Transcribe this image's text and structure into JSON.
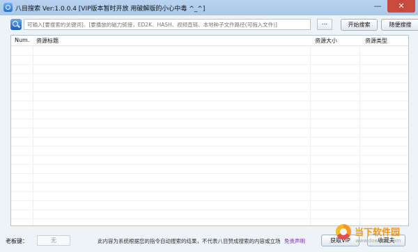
{
  "window": {
    "title": "八目搜索 Ver:1.0.0.4 [VIP版本暂时开放 用破解版的小心中毒 ^_^]",
    "minimize": "—",
    "close": "✕"
  },
  "search": {
    "placeholder": "可输入[要搜索的关键词]、[要播放的磁力链接，ED2K、HASH、视频直链、本地种子文件路径(可拖入文件)]",
    "browse_label": "...",
    "start_label": "开始搜索",
    "random_label": "随便搜搜"
  },
  "table": {
    "columns": [
      "Num.",
      "资源标题",
      "资源大小",
      "资源类型"
    ],
    "rows": []
  },
  "footer": {
    "key_label": "老板键：",
    "key_value": "无",
    "notice": "此内容为系统根据您的指令自动搜索的结果，不代表八目赞成搜索的内容或立场",
    "disclaimer": "免责声明",
    "vip_label": "获取VIP",
    "fav_label": "收藏夫"
  },
  "watermark": {
    "brand": "当下软件园",
    "url": "www.downxia.com"
  },
  "icons": {
    "app": "app-icon",
    "search": "search-icon",
    "logo": "watermark-logo"
  }
}
